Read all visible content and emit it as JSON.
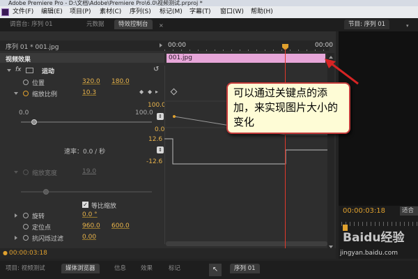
{
  "window": {
    "title": "Adobe Premiere Pro - D:\\文档\\Adobe\\Premiere Pro\\6.0\\视频测试.prproj *"
  },
  "menu": [
    "文件(F)",
    "编辑(E)",
    "项目(P)",
    "素材(C)",
    "序列(S)",
    "标记(M)",
    "字幕(T)",
    "窗口(W)",
    "帮助(H)"
  ],
  "top_tabs": [
    "调音台: 序列 01",
    "元数据",
    "特效控制台",
    "节目: 序列 01"
  ],
  "effect_controls": {
    "sequence_label": "序列 01 * 001.jpg",
    "section_title": "视频效果",
    "motion_label": "运动",
    "timecode_start": "00:00",
    "timecode_end": "00:00",
    "clip_name": "001.jpg",
    "position": {
      "label": "位置",
      "x": "320.0",
      "y": "180.0"
    },
    "scale": {
      "label": "缩放比例",
      "value": "10.3",
      "min": "0.0",
      "max": "100.0",
      "graph_max": "100.0",
      "graph_min": "0.0",
      "value_knob_fraction": 0.103
    },
    "velocity": {
      "top": "12.6",
      "label": "速率：0.0 / 秒",
      "bottom": "-12.6"
    },
    "scale_width": {
      "label": "缩放宽度",
      "value": "19.0",
      "value_knob_fraction": 0.19
    },
    "uniform_scale": "等比缩放",
    "rotation": {
      "label": "旋转",
      "value": "0.0 °"
    },
    "anchor": {
      "label": "定位点",
      "x": "960.0",
      "y": "600.0"
    },
    "antiflicker": {
      "label": "抗闪烁过滤",
      "value": "0.00"
    },
    "footer_timecode": "00:00:03:18"
  },
  "program": {
    "timecode": "00:00:03:18",
    "fit_label": "适合"
  },
  "bottom_tabs": [
    "项目: 视频测试",
    "媒体浏览器",
    "信息",
    "效果",
    "标记"
  ],
  "timeline_tab": "序列 01",
  "callout": {
    "text": "可以通过关键点的添加，来实现图片大小的变化"
  },
  "watermark": {
    "site": "jingyan.baidu.com",
    "brand": "Baidu经验"
  },
  "colors": {
    "accent": "#e0a12e",
    "clip": "#e7a6d9",
    "playhead": "#e0392b",
    "arrow": "#d62424"
  }
}
